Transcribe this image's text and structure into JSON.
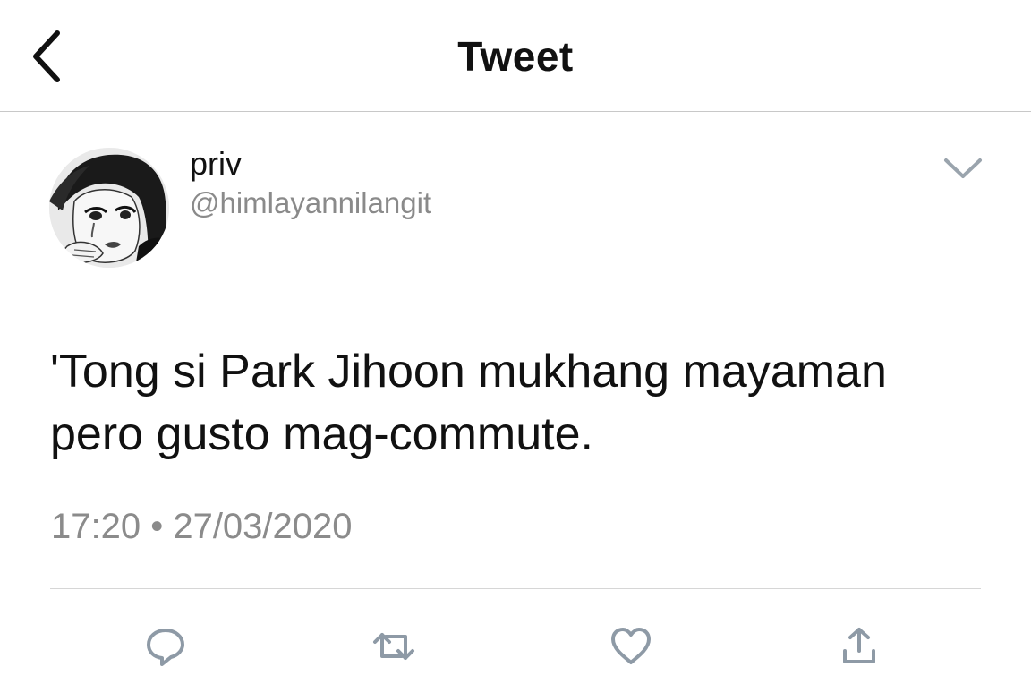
{
  "header": {
    "title": "Tweet"
  },
  "tweet": {
    "author": {
      "display_name": "priv",
      "handle": "@himlayannilangit"
    },
    "text_line1": "'Tong si Park Jihoon mukhang mayaman",
    "text_line2": "pero gusto mag-commute.",
    "timestamp": "17:20 • 27/03/2020"
  },
  "icons": {
    "back": "chevron-left-icon",
    "caret": "chevron-down-icon",
    "reply": "reply-icon",
    "retweet": "retweet-icon",
    "like": "heart-icon",
    "share": "share-icon"
  },
  "colors": {
    "text": "#111111",
    "secondary": "#8a8a8a",
    "icon": "#8e9aa6",
    "divider": "#d6d6d6"
  }
}
